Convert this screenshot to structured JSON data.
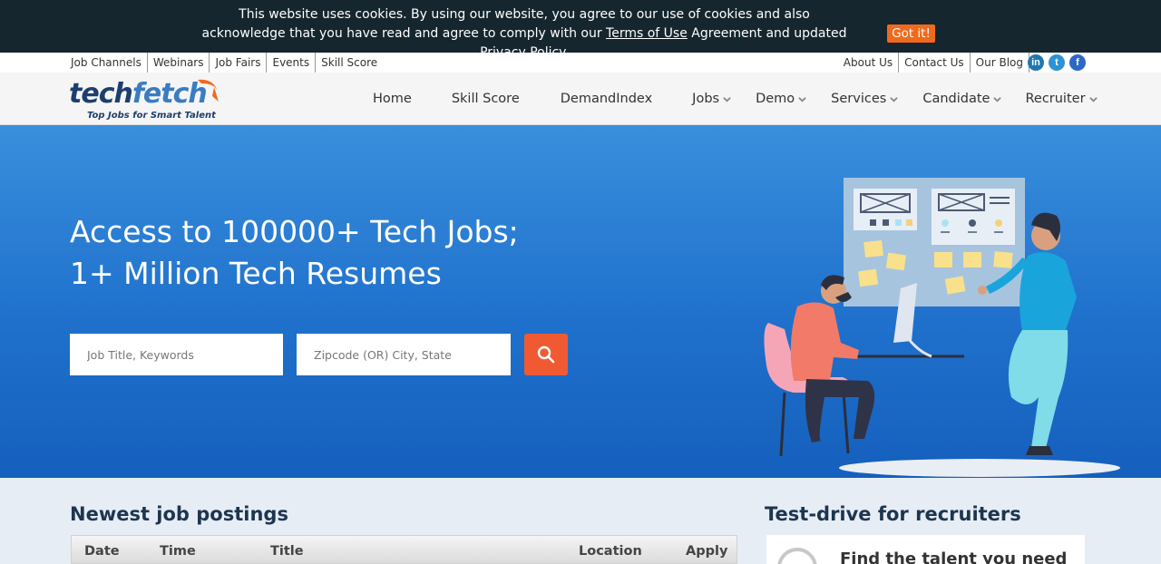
{
  "cookie": {
    "line1": "This website uses cookies. By using our website, you agree to our use of cookies and also",
    "line2_pre": "acknowledge that you have read and agree to comply with our ",
    "terms": "Terms of Use",
    "line2_mid": " Agreement and updated ",
    "privacy": "Privacy Policy",
    "line2_end": ".",
    "button": "Got it!"
  },
  "util": {
    "left": [
      "Job Channels",
      "Webinars",
      "Job Fairs",
      "Events",
      "Skill Score"
    ],
    "right": [
      "About Us",
      "Contact Us",
      "Our Blog"
    ],
    "social": [
      "in",
      "t",
      "f"
    ]
  },
  "logo": {
    "name_a": "tech",
    "name_b": "fetch",
    "tagline": "Top Jobs for Smart Talent"
  },
  "nav": {
    "items": [
      {
        "label": "Home"
      },
      {
        "label": "Skill Score"
      },
      {
        "label": "DemandIndex"
      },
      {
        "label": "Jobs"
      },
      {
        "label": "Demo"
      },
      {
        "label": "Services"
      },
      {
        "label": "Candidate"
      },
      {
        "label": "Recruiter"
      }
    ]
  },
  "hero": {
    "line1": "Access to 100000+ Tech Jobs;",
    "line2": "1+ Million Tech Resumes",
    "keyword_placeholder": "Job Title, Keywords",
    "location_placeholder": "Zipcode (OR) City, State"
  },
  "jobs": {
    "title": "Newest job postings",
    "columns": [
      "Date",
      "Time",
      "Title",
      "Location",
      "Apply"
    ]
  },
  "recruiters": {
    "title": "Test-drive for recruiters",
    "card_text": "Find the talent you need"
  },
  "colors": {
    "accent": "#f05a33",
    "hero": "#1f71cc",
    "navy": "#1e3550",
    "cookie_bg": "#15262e"
  }
}
